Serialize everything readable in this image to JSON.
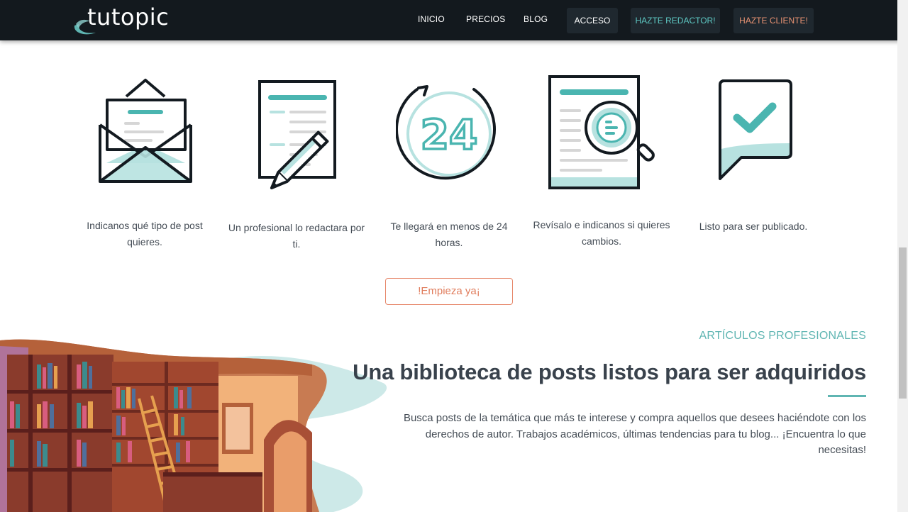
{
  "nav": {
    "logo_text": "tutopic",
    "links": {
      "inicio": "INICIO",
      "precios": "PRECIOS",
      "blog": "BLOG",
      "acceso": "ACCESO",
      "redactor": "HAZTE REDACTOR!",
      "cliente": "HAZTE CLIENTE!"
    }
  },
  "steps": [
    {
      "icon": "envelope-icon",
      "text": "Indicanos qué tipo de post quieres."
    },
    {
      "icon": "document-pencil-icon",
      "text": "Un profesional lo redactara por ti."
    },
    {
      "icon": "clock-24-icon",
      "text": "Te llegará en menos de 24 horas."
    },
    {
      "icon": "document-search-icon",
      "text": "Revísalo e indicanos si quieres cambios."
    },
    {
      "icon": "checkmark-bubble-icon",
      "text": "Listo para ser publicado."
    }
  ],
  "icon_24_label": "24",
  "cta_label": "!Empieza ya¡",
  "library": {
    "eyebrow": "ARTÍCULOS PROFESIONALES",
    "headline": "Una biblioteca de posts listos para ser adquiridos",
    "paragraph": "Busca posts de la temática que más te interese y compra aquellos que desees haciéndote con los derechos de autor. Trabajos académicos, últimas tendencias para tu blog... ¡Encuentra lo que necesitas!"
  },
  "colors": {
    "navbar_bg": "#13191e",
    "teal": "#4ab5b0",
    "teal_light": "#b7e2e0",
    "dark_stroke": "#131a20",
    "cta_orange": "#e07c5c",
    "redactor_teal": "#5ec8c3",
    "cliente_orange": "#e79272"
  }
}
